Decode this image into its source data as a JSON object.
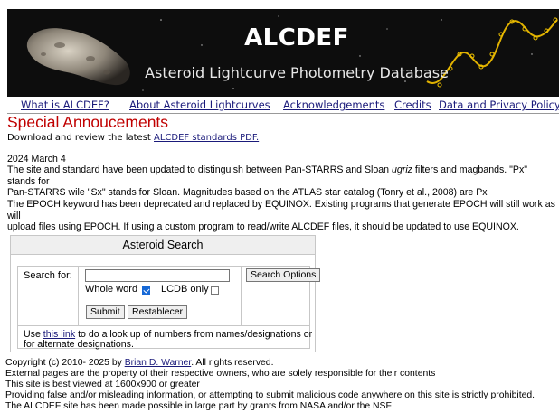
{
  "banner": {
    "title": "ALCDEF",
    "subtitle": "Asteroid Lightcurve Photometry Database"
  },
  "nav": {
    "items": [
      {
        "label": "What is ALCDEF?"
      },
      {
        "label": "About Asteroid Lightcurves"
      },
      {
        "label": "Acknowledgements"
      },
      {
        "label": "Credits"
      },
      {
        "label": "Data and Privacy Policy"
      }
    ]
  },
  "announcements": {
    "title": "Special Annoucements",
    "download_prefix": "Download and review the latest ",
    "download_link": "ALCDEF standards PDF.",
    "date": "2024 March 4",
    "para1_a": "The site and standard have been updated to distinguish between Pan-STARRS and Sloan ",
    "para1_em": "ugriz",
    "para1_b": " filters and magbands. \"Px\" stands for",
    "para1_c": "Pan-STARRS wile \"Sx\" stands for Sloan. Magnitudes based on the ATLAS star catalog (Tonry et al., 2008) are Px",
    "para2_a": "The EPOCH keyword has been deprecated and replaced by EQUINOX. Existing programs that generate EPOCH will still work as will",
    "para2_b": "upload files using EPOCH. If using a custom program to read/write ALCDEF files, it should be updated to use EQUINOX."
  },
  "search": {
    "heading": "Asteroid Search",
    "label": "Search for:",
    "value": "",
    "options_button": "Search Options",
    "whole_word_label": "Whole word",
    "whole_word_checked": true,
    "lcdb_only_label": "LCDB only",
    "lcdb_only_checked": false,
    "submit_button": "Submit",
    "reset_button": "Restablecer",
    "help_prefix": "Use ",
    "help_link": "this link",
    "help_suffix": " to do a look up of numbers from names/designations or",
    "help_line2": "for alternate designations."
  },
  "footer": {
    "copyright_prefix": "Copyright (c) 2010- 2025 by ",
    "copyright_link": "Brian D. Warner",
    "copyright_suffix": ". All rights reserved.",
    "line2": "External pages are the property of their respective owners, who are solely responsible for their contents",
    "line3": "This site is best viewed at 1600x900 or greater",
    "line4": "Providing false and/or misleading information, or attempting to submit malicious code anywhere on this site is strictly prohibited.",
    "line5": "The ALCDEF site has been made possible in large part by grants from NASA and/or the NSF"
  },
  "colors": {
    "heading_red": "#c00000",
    "link": "#1a1a7a",
    "checkbox_checked": "#1668d6"
  }
}
